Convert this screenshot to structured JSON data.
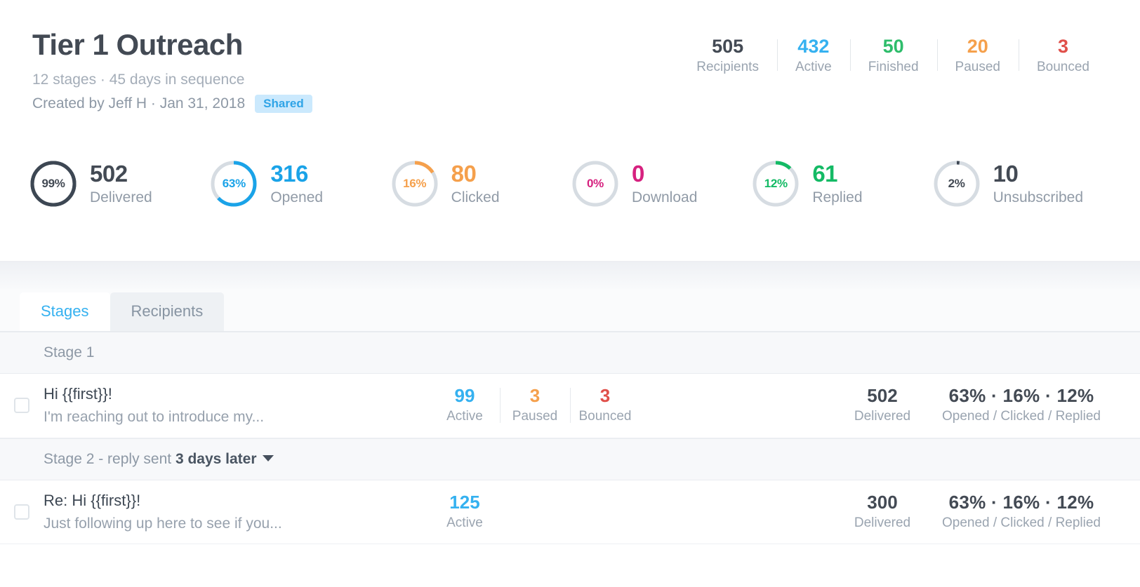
{
  "header": {
    "title": "Tier 1 Outreach",
    "subtitle": "12 stages · 45 days in sequence",
    "created": "Created by Jeff H · Jan 31, 2018",
    "badge": "Shared"
  },
  "top_stats": [
    {
      "value": "505",
      "label": "Recipients",
      "color": "#434a54"
    },
    {
      "value": "432",
      "label": "Active",
      "color": "#35b1f0"
    },
    {
      "value": "50",
      "label": "Finished",
      "color": "#2ebd6b"
    },
    {
      "value": "20",
      "label": "Paused",
      "color": "#f5a04c"
    },
    {
      "value": "3",
      "label": "Bounced",
      "color": "#e0504a"
    }
  ],
  "metrics": [
    {
      "percent": "99%",
      "pct_value": 99,
      "value": "502",
      "label": "Delivered",
      "color": "#3d4753",
      "track": "#3d4753",
      "num_color": "#434a54"
    },
    {
      "percent": "63%",
      "pct_value": 63,
      "value": "316",
      "label": "Opened",
      "color": "#1aa3e8",
      "track": "#d6dce2",
      "num_color": "#1aa3e8"
    },
    {
      "percent": "16%",
      "pct_value": 16,
      "value": "80",
      "label": "Clicked",
      "color": "#f5a04c",
      "track": "#d6dce2",
      "num_color": "#f5a04c"
    },
    {
      "percent": "0%",
      "pct_value": 0,
      "value": "0",
      "label": "Download",
      "color": "#d6217f",
      "track": "#d6dce2",
      "num_color": "#d6217f"
    },
    {
      "percent": "12%",
      "pct_value": 12,
      "value": "61",
      "label": "Replied",
      "color": "#14ba65",
      "track": "#d6dce2",
      "num_color": "#14ba65"
    },
    {
      "percent": "2%",
      "pct_value": 2,
      "value": "10",
      "label": "Unsubscribed",
      "color": "#3d4753",
      "track": "#d6dce2",
      "num_color": "#434a54"
    }
  ],
  "tabs": [
    {
      "label": "Stages",
      "active": true
    },
    {
      "label": "Recipients",
      "active": false
    }
  ],
  "table": {
    "sections": [
      {
        "header_plain": "Stage 1",
        "header_strong": "",
        "has_caret": false,
        "rows": [
          {
            "subject": "Hi {{first}}!",
            "preview": "I'm reaching out to introduce my...",
            "mid_stats": [
              {
                "value": "99",
                "label": "Active",
                "color": "#35b1f0"
              },
              {
                "value": "3",
                "label": "Paused",
                "color": "#f5a04c"
              },
              {
                "value": "3",
                "label": "Bounced",
                "color": "#e0504a"
              }
            ],
            "delivered_value": "502",
            "delivered_label": "Delivered",
            "rates_value": "63%  ·  16%  ·  12%",
            "rates_label": "Opened / Clicked / Replied"
          }
        ]
      },
      {
        "header_plain": "Stage 2 - reply sent ",
        "header_strong": "3 days later",
        "has_caret": true,
        "rows": [
          {
            "subject": "Re: Hi {{first}}!",
            "preview": "Just following up here to see if you...",
            "mid_stats": [
              {
                "value": "125",
                "label": "Active",
                "color": "#35b1f0"
              }
            ],
            "delivered_value": "300",
            "delivered_label": "Delivered",
            "rates_value": "63%  ·  16%  ·  12%",
            "rates_label": "Opened / Clicked / Replied"
          }
        ]
      }
    ]
  }
}
